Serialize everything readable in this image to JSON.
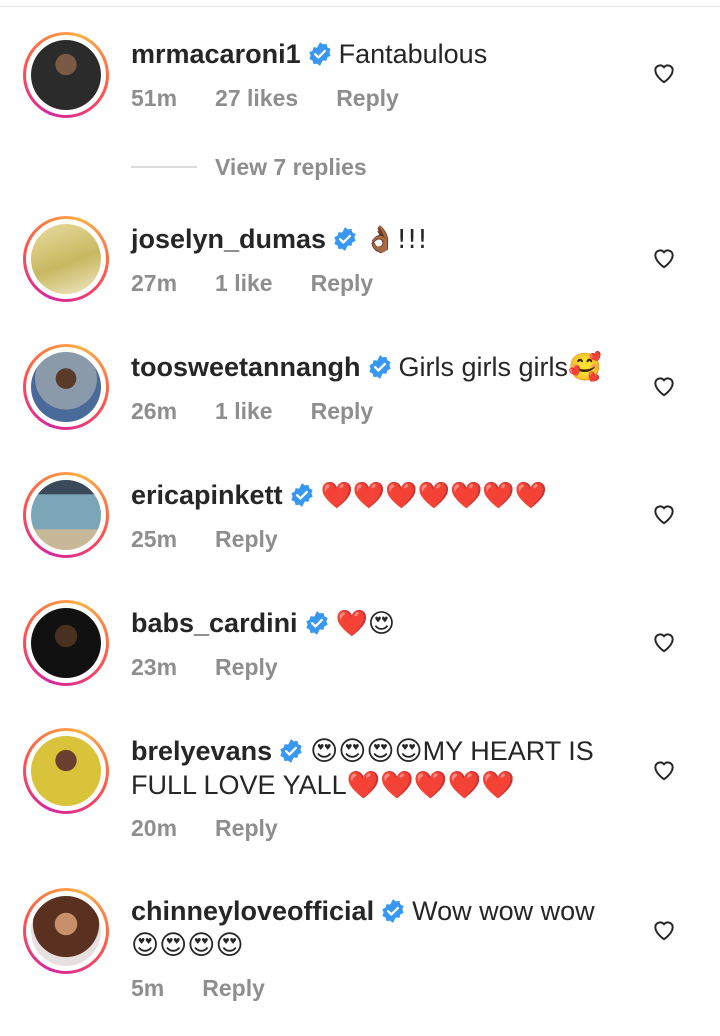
{
  "comments": [
    {
      "username": "mrmacaroni1",
      "text": "Fantabulous",
      "time": "51m",
      "likes": "27 likes",
      "reply": "Reply",
      "avatar_color": "#2b2b2b"
    },
    {
      "username": "joselyn_dumas",
      "text": "👌🏾!!!",
      "time": "27m",
      "likes": "1 like",
      "reply": "Reply",
      "avatar_color": "#c8b860"
    },
    {
      "username": "toosweetannangh",
      "text": "Girls girls girls🥰",
      "time": "26m",
      "likes": "1 like",
      "reply": "Reply",
      "avatar_color": "#6b7b8c"
    },
    {
      "username": "ericapinkett",
      "text": "❤️❤️❤️❤️❤️❤️❤️",
      "time": "25m",
      "likes": "",
      "reply": "Reply",
      "avatar_color": "#7aa6b8"
    },
    {
      "username": "babs_cardini",
      "text": "❤️😍",
      "time": "23m",
      "likes": "",
      "reply": "Reply",
      "avatar_color": "#1a1a1a"
    },
    {
      "username": "brelyevans",
      "text": "😍😍😍😍MY HEART IS FULL LOVE YALL❤️❤️❤️❤️❤️",
      "time": "20m",
      "likes": "",
      "reply": "Reply",
      "avatar_color": "#d8c33a"
    },
    {
      "username": "chinneyloveofficial",
      "text": "Wow wow wow 😍😍😍😍",
      "time": "5m",
      "likes": "",
      "reply": "Reply",
      "avatar_color": "#9a6a55"
    }
  ],
  "view_replies": "View 7 replies",
  "colors": {
    "verified_blue": "#3897f0",
    "meta_gray": "#8e8e8e",
    "text": "#262626"
  }
}
